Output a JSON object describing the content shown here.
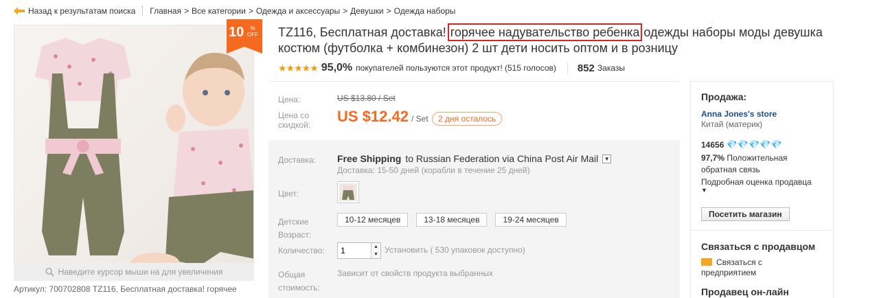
{
  "breadcrumb": {
    "back": "Назад к результатам поиска",
    "items": [
      "Главная",
      "Все категории",
      "Одежда и аксессуары",
      "Девушки",
      "Одежда наборы"
    ],
    "separator": ">"
  },
  "gallery": {
    "discount_value": "10",
    "discount_pct": "%",
    "discount_off": "OFF",
    "zoom_hint": "Наведите курсор мыши на для увеличения",
    "article": "Артикул: 700702808 TZ116, Бесплатная доставка! горячее"
  },
  "product": {
    "title_before": "TZ116, Бесплатная доставка! ",
    "title_highlight": "горячее надувательство ребенка",
    "title_after": " одежды наборы моды девушка костюм (футболка + комбинезон) 2 шт дети носить оптом и в розницу"
  },
  "rating": {
    "stars": "★★★★★",
    "percent": "95,0%",
    "text": "покупателей пользуются этот продукт! (515 голосов)",
    "orders_count": "852",
    "orders_label": "Заказы"
  },
  "price": {
    "price_label": "Цена:",
    "old_price": "US $13.80 / Set",
    "discount_label": "Цена со скидкой:",
    "new_price": "US $12.42",
    "unit": "/ Set",
    "days_left": "2 дня осталось"
  },
  "options": {
    "shipping_label": "Доставка:",
    "shipping_free": "Free Shipping",
    "shipping_to": "to Russian Federation via China Post Air Mail",
    "shipping_sub": "Доставка: 15-50 дней (корабли в течение 25 дней)",
    "color_label": "Цвет:",
    "size_label": "Детские Возраст:",
    "sizes": [
      "10-12 месяцев",
      "13-18 месяцев",
      "19-24 месяцев"
    ],
    "qty_label": "Количество:",
    "qty_value": "1",
    "qty_note": "Установить ( 530 упаковок доступно)",
    "total_label": "Общая стоимость:",
    "total_note": "Зависит от свойств продукта выбранных"
  },
  "seller": {
    "heading": "Продажа:",
    "store_name": "Anna Jones's store",
    "location": "Китай (материк)",
    "score": "14656",
    "diamonds": "💎💎💎💎💎",
    "feedback_pct": "97,7%",
    "feedback_text1": "Положительная",
    "feedback_text2": "обратная связь",
    "detail_rating": "Подробная оценка продавца",
    "visit_button": "Посетить магазин",
    "contact_heading": "Связаться с продавцом",
    "contact_link1": "Связаться с",
    "contact_link2": "предприятием",
    "online_heading": "Продавец он-лайн"
  },
  "colors": {
    "accent_orange": "#f56a1f",
    "highlight_red": "#d9242c",
    "link_blue": "#1b4c8c",
    "star_orange": "#f39c12"
  }
}
